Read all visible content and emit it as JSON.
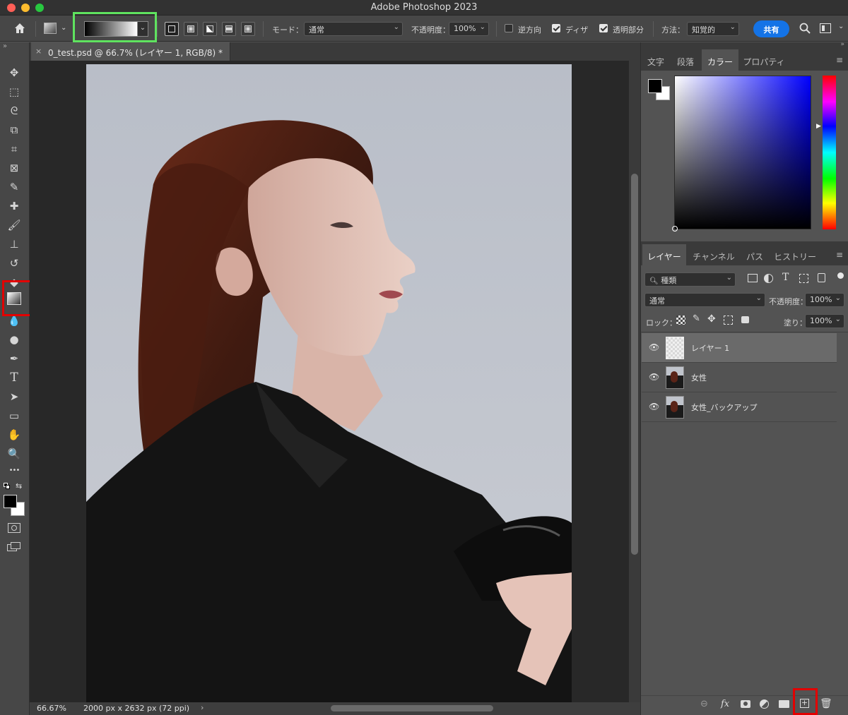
{
  "window": {
    "title": "Adobe Photoshop 2023",
    "traffic_colors": [
      "#ff5f57",
      "#febc2e",
      "#28c840"
    ]
  },
  "options_bar": {
    "mode_label": "モード：",
    "mode_value": "通常",
    "opacity_label": "不透明度：",
    "opacity_value": "100%",
    "reverse_label": "逆方向",
    "dither_label": "ディザ",
    "transparency_label": "透明部分",
    "method_label": "方法：",
    "method_value": "知覚的",
    "share_label": "共有",
    "reverse_checked": false,
    "dither_checked": true,
    "transparency_checked": true
  },
  "document_tab": {
    "title": "0_test.psd @ 66.7% (レイヤー 1, RGB/8) *",
    "close_symbol": "×"
  },
  "status_bar": {
    "zoom": "66.67%",
    "doc_info": "2000 px x 2632 px (72 ppi)",
    "arrow": "›"
  },
  "color_panel": {
    "tabs": [
      "文字",
      "段落",
      "カラー",
      "プロパティ"
    ],
    "active_tab": "カラー",
    "hue_color": "#0000ff"
  },
  "layers_panel": {
    "tabs": [
      "レイヤー",
      "チャンネル",
      "パス",
      "ヒストリー"
    ],
    "active_tab": "レイヤー",
    "filter_label": "種類",
    "blend_mode": "通常",
    "opacity_label": "不透明度：",
    "opacity_value": "100%",
    "lock_label": "ロック：",
    "fill_label": "塗り：",
    "fill_value": "100%",
    "layers": [
      {
        "name": "レイヤー 1",
        "selected": true,
        "type": "transparent"
      },
      {
        "name": "女性",
        "selected": false,
        "type": "photo"
      },
      {
        "name": "女性_バックアップ",
        "selected": false,
        "type": "photo"
      }
    ],
    "bottom_icons": [
      "link-icon",
      "fx-icon",
      "mask-icon",
      "adjustment-icon",
      "folder-icon",
      "new-layer-icon",
      "trash-icon"
    ]
  },
  "tools": [
    {
      "name": "move-tool-icon",
      "glyph": "✥"
    },
    {
      "name": "marquee-tool-icon",
      "glyph": "⬚"
    },
    {
      "name": "lasso-tool-icon",
      "glyph": "ᘓ"
    },
    {
      "name": "object-select-tool-icon",
      "glyph": "⧉"
    },
    {
      "name": "crop-tool-icon",
      "glyph": "⌗"
    },
    {
      "name": "frame-tool-icon",
      "glyph": "⊠"
    },
    {
      "name": "eyedropper-tool-icon",
      "glyph": "✎"
    },
    {
      "name": "healing-tool-icon",
      "glyph": "✚"
    },
    {
      "name": "brush-tool-icon",
      "glyph": "🖌"
    },
    {
      "name": "stamp-tool-icon",
      "glyph": "⊥"
    },
    {
      "name": "history-brush-tool-icon",
      "glyph": "↺"
    },
    {
      "name": "eraser-tool-icon",
      "glyph": "◆"
    },
    {
      "name": "gradient-tool-icon",
      "glyph": ""
    },
    {
      "name": "blur-tool-icon",
      "glyph": "💧"
    },
    {
      "name": "dodge-tool-icon",
      "glyph": "●"
    },
    {
      "name": "pen-tool-icon",
      "glyph": "✒"
    },
    {
      "name": "type-tool-icon",
      "glyph": "T"
    },
    {
      "name": "path-select-tool-icon",
      "glyph": "➤"
    },
    {
      "name": "rectangle-tool-icon",
      "glyph": "▭"
    },
    {
      "name": "hand-tool-icon",
      "glyph": "✋"
    },
    {
      "name": "zoom-tool-icon",
      "glyph": "🔍"
    },
    {
      "name": "more-tools-icon",
      "glyph": "•••"
    }
  ],
  "colors": {
    "foreground": "#000000",
    "background": "#ffffff",
    "highlight_red": "#e20000",
    "highlight_green": "#5fe35f"
  }
}
